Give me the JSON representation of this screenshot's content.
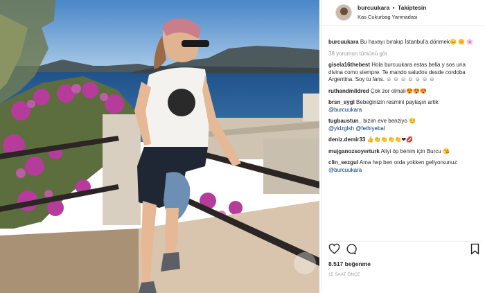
{
  "post": {
    "username": "burcuukara",
    "dot": "•",
    "follow_label": "Takiptesin",
    "location": "Kas Cukurbag Yarimadasi"
  },
  "caption": {
    "username": "burcuukara",
    "text": "Bu havayı bırakıp İstanbul'a dönmek😑 🌼 🌸"
  },
  "view_all_comments": "38 yorumun tümünü gör",
  "comments": [
    {
      "username": "gisela16thebest",
      "text": "Hola burcuukara estas bella y sos una divina como siempre. Te mando saludos desde cordoba Argentina. Soy tu fans. ☺ ☺ ☺ ☺ ☺ ☺ ☺"
    },
    {
      "username": "ruthandmildred",
      "text": "Çok zor olmalı😍😍😍"
    },
    {
      "username": "brsn_sygl",
      "text": "Bebeğinizin resmini paylaşın artik",
      "mention": "@burcuukara"
    },
    {
      "username": "tugbaustun_",
      "text": "bizim eve benziyo 😔",
      "mention": "@yldzglsh @fethiyebal"
    },
    {
      "username": "deniz.demir33",
      "text": "👍👏👏👏👏❤💋"
    },
    {
      "username": "mujganozsoyerturk",
      "text": "Aliyi öp benim için Burcu 😘"
    },
    {
      "username": "clin_sezgul",
      "text": "Ama hep ben orda yokken geliyorsunuz",
      "mention": "@burcuukara"
    }
  ],
  "icons": {
    "like": "heart-icon",
    "comment": "comment-icon",
    "save": "bookmark-icon"
  },
  "likes": "8.517 beğenme",
  "timestamp": "15 SAAT ÖNCE"
}
